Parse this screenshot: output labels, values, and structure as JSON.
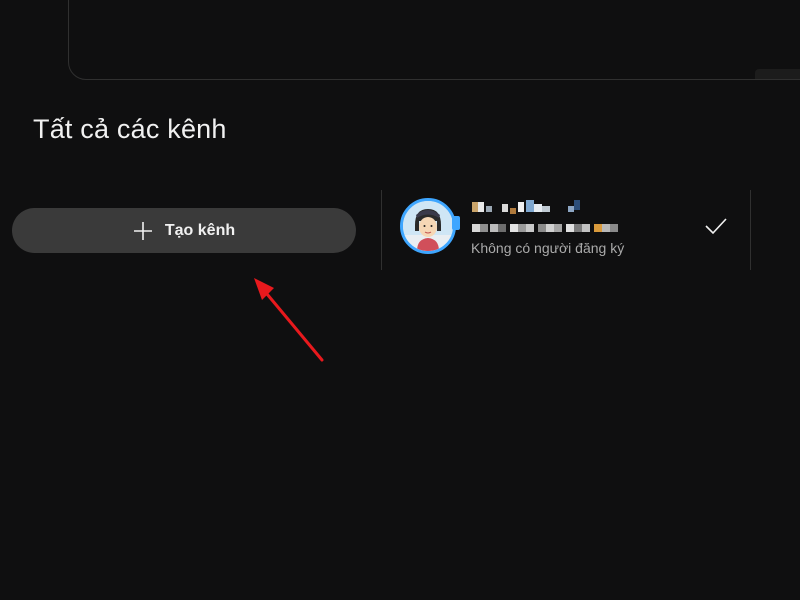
{
  "section": {
    "title": "Tất cả các kênh"
  },
  "create_channel": {
    "label": "Tạo kênh",
    "icon": "plus-icon"
  },
  "channel": {
    "name_redacted": true,
    "handle_redacted": true,
    "subscribers": "Không có người đăng ký",
    "selected_icon": "checkmark-icon",
    "avatar_ring_color": "#3ea6ff"
  },
  "annotation": {
    "arrow_color": "#e8191d"
  },
  "colors": {
    "background": "#0f0f10",
    "button_bg": "#3a3a3a",
    "text_primary": "#f1f1f1",
    "text_secondary": "#aaaaaa"
  }
}
